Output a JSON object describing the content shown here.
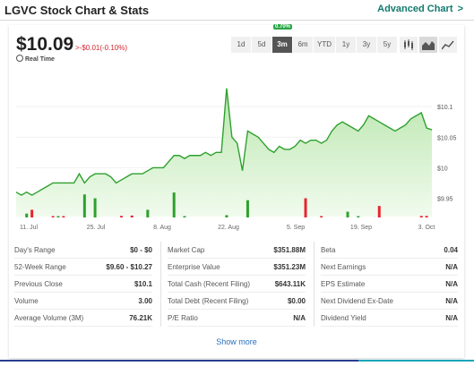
{
  "header": {
    "title": "LGVC Stock Chart & Stats",
    "advanced_link": "Advanced Chart",
    "advanced_chevron": ">"
  },
  "quote": {
    "price": "$10.09",
    "change": ">-$0.01(-0.10%)",
    "realtime_label": "Real Time"
  },
  "ranges": [
    "1d",
    "5d",
    "3m",
    "6m",
    "YTD",
    "1y",
    "3y",
    "5y"
  ],
  "active_range": "3m",
  "range_badge": "0.70%",
  "chart_types": [
    "candlestick-icon",
    "area-chart-icon",
    "line-chart-icon"
  ],
  "colors": {
    "up": "#2ea12e",
    "down": "#e8252f",
    "area_fill": "#d8f0d2",
    "area_line": "#2ea12e",
    "link": "#2a6ebb",
    "accent": "#127a6e"
  },
  "chart_data": {
    "type": "area",
    "x_tick_labels": [
      "11. Jul",
      "25. Jul",
      "8. Aug",
      "22. Aug",
      "5. Sep",
      "19. Sep",
      "3. Oct"
    ],
    "y_tick_labels": [
      "$9.95",
      "$10",
      "$10.05",
      "$10.1"
    ],
    "ylim": [
      9.92,
      10.15
    ],
    "price": [
      9.96,
      9.955,
      9.96,
      9.955,
      9.96,
      9.965,
      9.97,
      9.975,
      9.975,
      9.975,
      9.975,
      9.975,
      9.99,
      9.975,
      9.985,
      9.99,
      9.99,
      9.99,
      9.985,
      9.975,
      9.98,
      9.985,
      9.99,
      9.99,
      9.99,
      9.995,
      10.0,
      10.0,
      10.0,
      10.01,
      10.02,
      10.02,
      10.015,
      10.02,
      10.02,
      10.02,
      10.025,
      10.02,
      10.025,
      10.025,
      10.13,
      10.05,
      10.04,
      9.995,
      10.06,
      10.055,
      10.05,
      10.04,
      10.03,
      10.025,
      10.035,
      10.03,
      10.03,
      10.035,
      10.045,
      10.04,
      10.045,
      10.045,
      10.04,
      10.045,
      10.06,
      10.07,
      10.075,
      10.07,
      10.065,
      10.06,
      10.07,
      10.085,
      10.08,
      10.075,
      10.07,
      10.065,
      10.06,
      10.065,
      10.07,
      10.08,
      10.085,
      10.09,
      10.065,
      10.062
    ],
    "volume": [
      0,
      0,
      1,
      0,
      2,
      0,
      0,
      0,
      0,
      0,
      0,
      0,
      0,
      0,
      0,
      0,
      0,
      0,
      0,
      0,
      0,
      0,
      0,
      0,
      0,
      0,
      0,
      0,
      0,
      0,
      0,
      0,
      0,
      0,
      0,
      0,
      0,
      0,
      0,
      0,
      0,
      0,
      0,
      0,
      0,
      0,
      0,
      0,
      0,
      0,
      0,
      0,
      0,
      0,
      0,
      0,
      0,
      0,
      0,
      0,
      0,
      0,
      0,
      0,
      0,
      0,
      0,
      0,
      0,
      0,
      0,
      0,
      0,
      0,
      0,
      0,
      0,
      0,
      0,
      0
    ],
    "volume_bars": [
      {
        "i": 2,
        "v": 1,
        "c": "up"
      },
      {
        "i": 3,
        "v": 2,
        "c": "down"
      },
      {
        "i": 7,
        "v": 0.3,
        "c": "down"
      },
      {
        "i": 8,
        "v": 0.3,
        "c": "up"
      },
      {
        "i": 9,
        "v": 0.3,
        "c": "down"
      },
      {
        "i": 13,
        "v": 6,
        "c": "up"
      },
      {
        "i": 15,
        "v": 5,
        "c": "up"
      },
      {
        "i": 20,
        "v": 0.4,
        "c": "down"
      },
      {
        "i": 22,
        "v": 0.5,
        "c": "down"
      },
      {
        "i": 25,
        "v": 2,
        "c": "up"
      },
      {
        "i": 30,
        "v": 6.5,
        "c": "up"
      },
      {
        "i": 32,
        "v": 0.3,
        "c": "up"
      },
      {
        "i": 40,
        "v": 0.6,
        "c": "up"
      },
      {
        "i": 44,
        "v": 4.5,
        "c": "up"
      },
      {
        "i": 55,
        "v": 5,
        "c": "down"
      },
      {
        "i": 58,
        "v": 0.3,
        "c": "down"
      },
      {
        "i": 63,
        "v": 1.5,
        "c": "up"
      },
      {
        "i": 65,
        "v": 0.3,
        "c": "up"
      },
      {
        "i": 69,
        "v": 3,
        "c": "down"
      },
      {
        "i": 77,
        "v": 0.4,
        "c": "down"
      },
      {
        "i": 78,
        "v": 0.4,
        "c": "down"
      }
    ]
  },
  "stats": {
    "col1": [
      {
        "k": "Day's Range",
        "v": "$0 - $0"
      },
      {
        "k": "52-Week Range",
        "v": "$9.60 - $10.27"
      },
      {
        "k": "Previous Close",
        "v": "$10.1"
      },
      {
        "k": "Volume",
        "v": "3.00"
      },
      {
        "k": "Average Volume (3M)",
        "v": "76.21K"
      }
    ],
    "col2": [
      {
        "k": "Market Cap",
        "v": "$351.88M"
      },
      {
        "k": "Enterprise Value",
        "v": "$351.23M"
      },
      {
        "k": "Total Cash (Recent Filing)",
        "v": "$643.11K"
      },
      {
        "k": "Total Debt (Recent Filing)",
        "v": "$0.00"
      },
      {
        "k": "P/E Ratio",
        "v": "N/A"
      }
    ],
    "col3": [
      {
        "k": "Beta",
        "v": "0.04"
      },
      {
        "k": "Next Earnings",
        "v": "N/A"
      },
      {
        "k": "EPS Estimate",
        "v": "N/A"
      },
      {
        "k": "Next Dividend Ex-Date",
        "v": "N/A"
      },
      {
        "k": "Dividend Yield",
        "v": "N/A"
      }
    ]
  },
  "show_more": "Show more"
}
